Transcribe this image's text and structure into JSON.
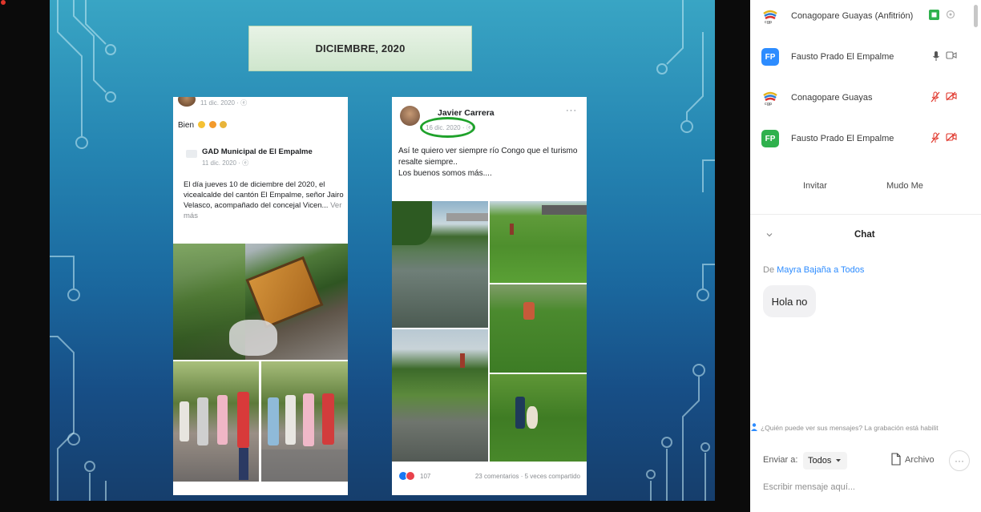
{
  "slide": {
    "title": "DICIEMBRE, 2020",
    "post1": {
      "time": "11 dic. 2020 · ⓔ",
      "text": "Bien",
      "shared_page": "GAD Municipal de El Empalme",
      "shared_time": "11 dic. 2020 · ⓔ",
      "shared_body": "El día jueves 10 de diciembre del 2020, el vicealcalde del cantón El Empalme, señor Jairo Velasco, acompañado del concejal Vicen...",
      "see_more": "Ver más"
    },
    "post2": {
      "author": "Javier Carrera",
      "time": "16 dic. 2020 · ⓔ",
      "menu": "···",
      "caption": "Así te quiero ver siempre río Congo que el turismo resalte siempre..\nLos buenos somos más....",
      "reactions_count": "107",
      "stats": "23 comentarios · 5 veces compartido"
    }
  },
  "participants": [
    {
      "name": "Conagopare Guayas (Anfitrión)",
      "avatar_type": "logo",
      "audio": "green-square-icon",
      "video": "circle-icon"
    },
    {
      "name": "Fausto Prado El Empalme",
      "avatar_type": "initials",
      "initials": "FP",
      "avatar_color": "#2d8cff",
      "audio": "microphone-icon",
      "video": "video-icon"
    },
    {
      "name": "Conagopare Guayas",
      "avatar_type": "logo",
      "audio": "muted-mic-icon",
      "video": "muted-video-icon"
    },
    {
      "name": "Fausto Prado El Empalme",
      "avatar_type": "initials",
      "initials": "FP",
      "avatar_color": "#2fb14d",
      "audio": "muted-mic-icon",
      "video": "muted-video-icon"
    }
  ],
  "panel": {
    "invite_label": "Invitar",
    "mute_label": "Mudo Me"
  },
  "chat": {
    "title": "Chat",
    "from_prefix": "De",
    "from_name": "Mayra Bajaña",
    "from_mid": "a",
    "to_name": "Todos",
    "message": "Hola no",
    "notice": "¿Quién puede ver sus mensajes? La grabación está habilit",
    "send_to_label": "Enviar a:",
    "send_to_value": "Todos",
    "file_label": "Archivo",
    "more": "···",
    "input_placeholder": "Escribir mensaje aquí..."
  },
  "colors": {
    "accent": "#2d8cff",
    "muted_red": "#e0362b",
    "highlight_circle": "#1fa22b"
  }
}
